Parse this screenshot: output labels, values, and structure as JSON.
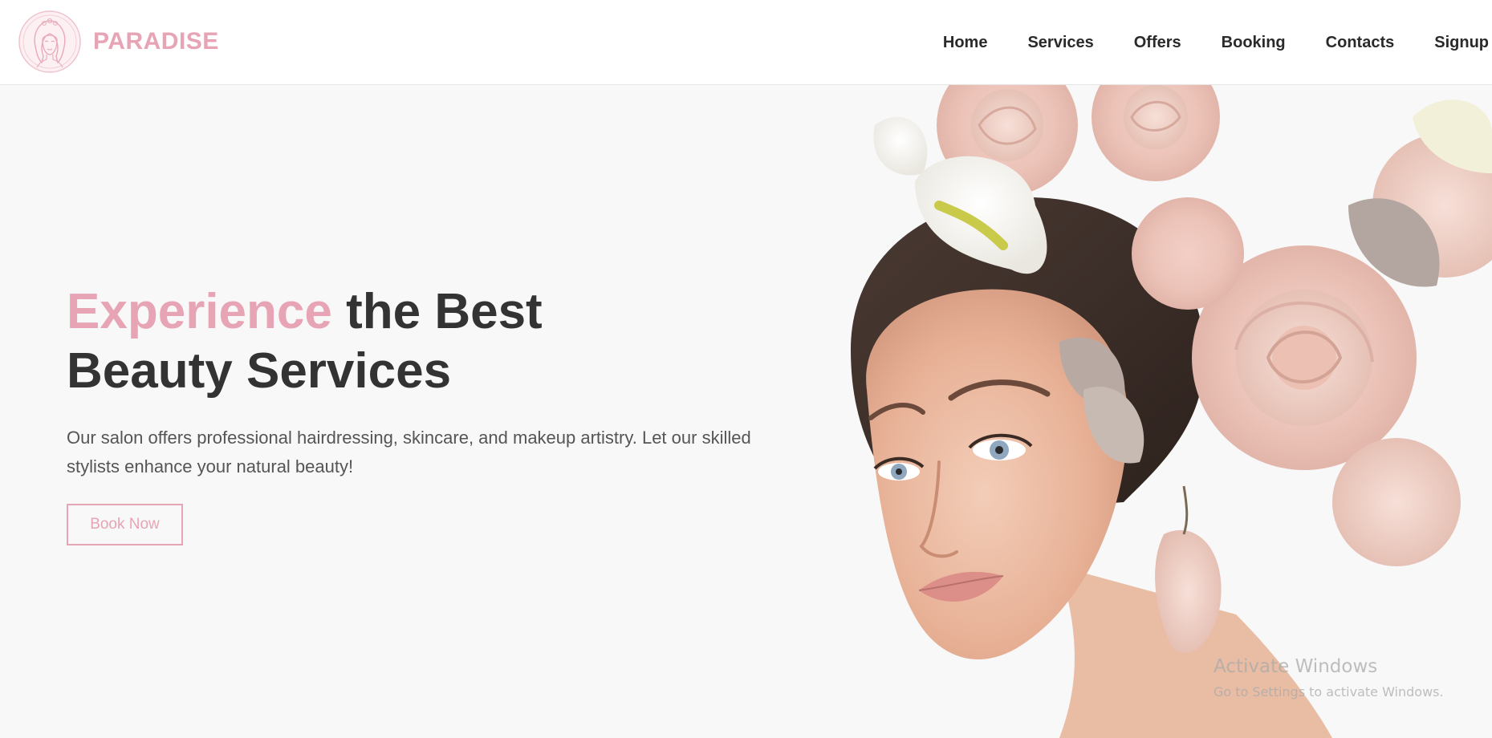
{
  "brand": {
    "name": "PARADISE",
    "logo_icon": "woman-face-logo-icon",
    "accent_color": "#e6a4b4"
  },
  "nav": {
    "items": [
      {
        "label": "Home"
      },
      {
        "label": "Services"
      },
      {
        "label": "Offers"
      },
      {
        "label": "Booking"
      },
      {
        "label": "Contacts"
      },
      {
        "label": "Signup"
      }
    ]
  },
  "hero": {
    "title_accent": "Experience",
    "title_rest_line1": "the Best",
    "title_line2": "Beauty Services",
    "description": "Our salon offers professional hairdressing, skincare, and makeup artistry. Let our skilled stylists enhance your natural beauty!",
    "cta_label": "Book Now",
    "image": "woman-with-flowers-image"
  },
  "watermark": {
    "title": "Activate Windows",
    "subtitle": "Go to Settings to activate Windows."
  },
  "colors": {
    "accent": "#e6a4b4",
    "text_dark": "#333333",
    "text_body": "#555555",
    "page_bg": "#f8f8f8",
    "header_bg": "#ffffff"
  }
}
